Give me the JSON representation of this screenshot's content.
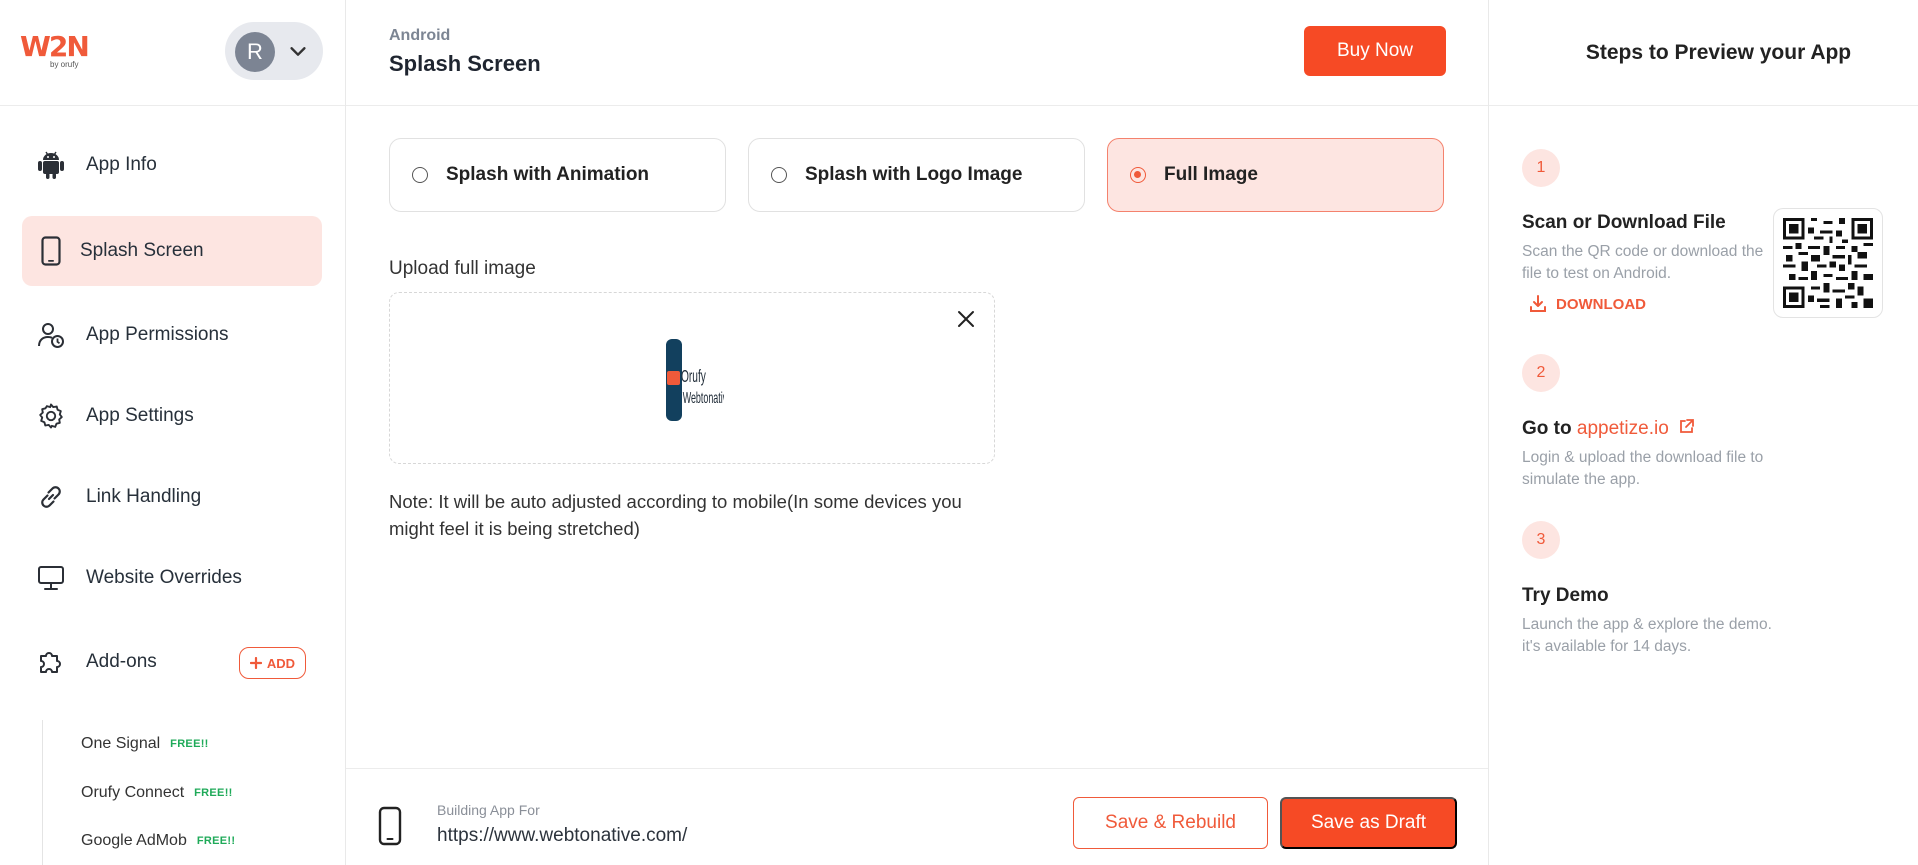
{
  "brand": {
    "logo_text": "W2N",
    "logo_sub": "by orufy",
    "accent": "#f64a25",
    "active_bg": "#fde5e1"
  },
  "profile": {
    "initial": "R",
    "menu_icon": "chevron-down-icon"
  },
  "sidebar": {
    "items": [
      {
        "label": "App Info",
        "icon": "android-icon"
      },
      {
        "label": "Splash Screen",
        "icon": "phone-icon",
        "active": true
      },
      {
        "label": "App Permissions",
        "icon": "user-clock-icon"
      },
      {
        "label": "App Settings",
        "icon": "gear-icon"
      },
      {
        "label": "Link Handling",
        "icon": "link-icon"
      },
      {
        "label": "Website Overrides",
        "icon": "monitor-icon"
      },
      {
        "label": "Add-ons",
        "icon": "puzzle-icon"
      }
    ],
    "add_label": "ADD",
    "addons": [
      {
        "label": "One Signal",
        "badge": "FREE!!"
      },
      {
        "label": "Orufy Connect",
        "badge": "FREE!!"
      },
      {
        "label": "Google AdMob",
        "badge": "FREE!!"
      }
    ]
  },
  "header": {
    "breadcrumb": "Android",
    "title": "Splash Screen",
    "buy_label": "Buy Now"
  },
  "splash_options": [
    {
      "label": "Splash with Animation",
      "selected": false
    },
    {
      "label": "Splash with Logo Image",
      "selected": false
    },
    {
      "label": "Full Image",
      "selected": true
    }
  ],
  "upload": {
    "label": "Upload full image",
    "thumb_text_1": "Orufy",
    "thumb_text_2": "Webtonative",
    "note": "Note: It will be auto adjusted according to mobile(In some devices you might feel it is being stretched)"
  },
  "footer": {
    "building_label": "Building App For",
    "url": "https://www.webtonative.com/",
    "rebuild_label": "Save & Rebuild",
    "draft_label": "Save as Draft"
  },
  "preview": {
    "title": "Steps to Preview your App",
    "steps": [
      {
        "num": "1",
        "title": "Scan or Download File",
        "desc": "Scan the QR code or download the file to test on Android."
      },
      {
        "num": "2",
        "title_prefix": "Go to ",
        "link": "appetize.io",
        "desc": "Login & upload the download file to simulate the app."
      },
      {
        "num": "3",
        "title": "Try Demo",
        "desc": "Launch the app & explore the demo. it's available for 14 days."
      }
    ],
    "download_label": "DOWNLOAD"
  }
}
